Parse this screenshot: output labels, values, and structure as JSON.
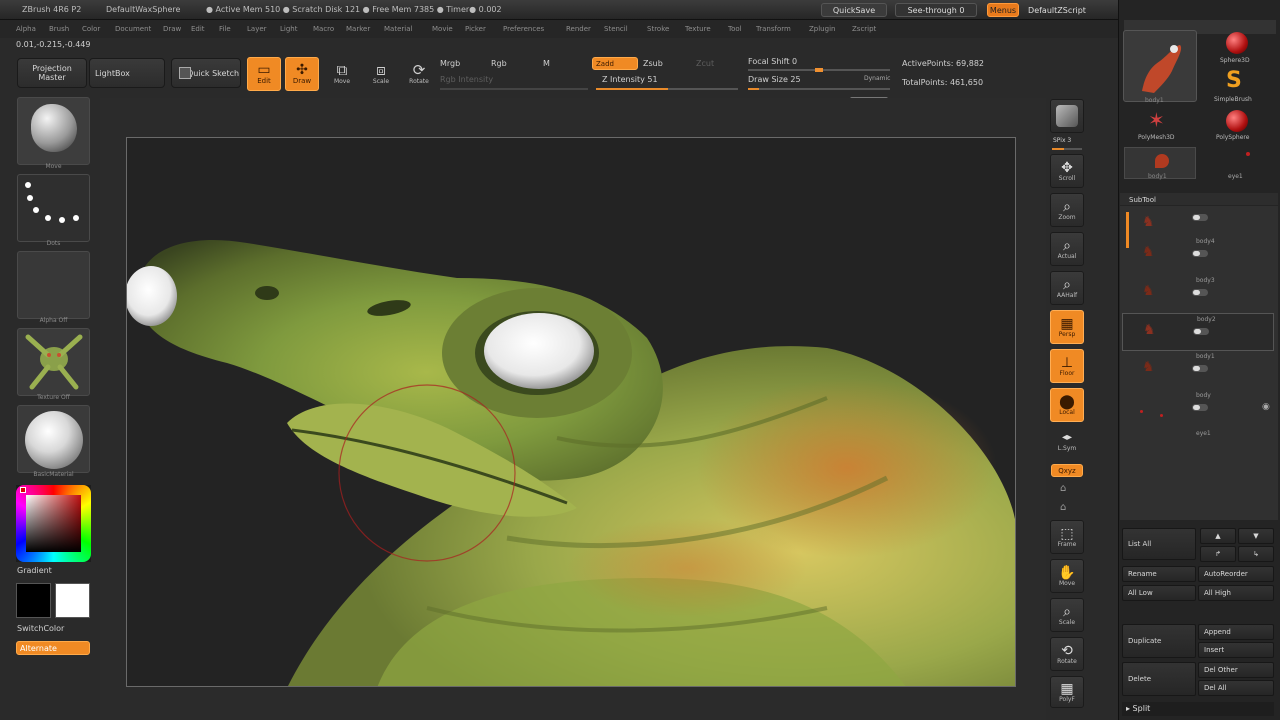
{
  "titlebar": {
    "app": "ZBrush 4R6 P2",
    "document": "DefaultWaxSphere",
    "stats": "● Active Mem 510 ● Scratch Disk 121 ● Free Mem 7385 ● Timer● 0.002",
    "quicksave": "QuickSave",
    "see_through": "See-through  0",
    "menus": "Menus",
    "default_zscript": "DefaultZScript"
  },
  "menubar": {
    "items": [
      "Alpha",
      "Brush",
      "Color",
      "Document",
      "Draw",
      "Edit",
      "File",
      "Layer",
      "Light",
      "Macro",
      "Marker",
      "Material",
      "Movie",
      "Picker",
      "Preferences",
      "Render",
      "Stencil",
      "Stroke",
      "Texture",
      "Tool",
      "Transform",
      "Zplugin",
      "Zscript"
    ]
  },
  "coords": "0.01,-0.215,-0.449",
  "shelf": {
    "projection_master": "Projection Master",
    "lightbox": "LightBox",
    "quick_sketch": "Quick Sketch",
    "edit": "Edit",
    "draw": "Draw",
    "move": "Move",
    "scale": "Scale",
    "rotate": "Rotate",
    "mrgb": "Mrgb",
    "rgb": "Rgb",
    "m": "M",
    "rgb_intensity": "Rgb Intensity",
    "zadd": "Zadd",
    "zsub": "Zsub",
    "zcut": "Zcut",
    "z_intensity": "Z Intensity 51",
    "focal_shift": "Focal Shift 0",
    "draw_size": "Draw Size 25",
    "dynamic": "Dynamic",
    "active_points": "ActivePoints: 69,882",
    "total_points": "TotalPoints: 461,650",
    "z_intensity_value": 0.51,
    "draw_size_level": 0.08,
    "focal_shift_level": 0.5
  },
  "left": {
    "brush_label": "Move",
    "stroke_label": "Dots",
    "alpha_label": "Alpha Off",
    "texture_label": "Texture Off",
    "material_label": "BasicMaterial",
    "gradient": "Gradient",
    "switch_color": "SwitchColor",
    "alternate": "Alternate"
  },
  "right_shelf": {
    "spix": "SPix 3",
    "scroll": "Scroll",
    "zoom": "Zoom",
    "actual": "Actual",
    "aahalf": "AAHalf",
    "persp": "Persp",
    "floor": "Floor",
    "local": "Local",
    "lsym": "L.Sym",
    "qxyz": "Qxyz",
    "frame": "Frame",
    "move": "Move",
    "scale": "Scale",
    "rotate": "Rotate",
    "polyf": "PolyF"
  },
  "panel": {
    "tool_thumbs": [
      {
        "label": "body1",
        "kind": "creature"
      },
      {
        "label": "Sphere3D",
        "kind": "sphere"
      },
      {
        "label": "SimpleBrush",
        "kind": "s-brush"
      },
      {
        "label": "PolyMesh3D",
        "kind": "star"
      },
      {
        "label": "PolySphere",
        "kind": "sphere"
      },
      {
        "label": "body1",
        "kind": "creature-small"
      },
      {
        "label": "eye1",
        "kind": "dot"
      }
    ],
    "subtool_title": "SubTool",
    "subtools": [
      "body4",
      "body3",
      "body2",
      "body1",
      "body",
      "eye1"
    ],
    "list_all": "List All",
    "rename": "Rename",
    "autoreorder": "AutoReorder",
    "all_low": "All Low",
    "all_high": "All High",
    "duplicate": "Duplicate",
    "append": "Append",
    "insert": "Insert",
    "delete": "Delete",
    "del_other": "Del Other",
    "del_all": "Del All",
    "split": "▸ Split"
  }
}
